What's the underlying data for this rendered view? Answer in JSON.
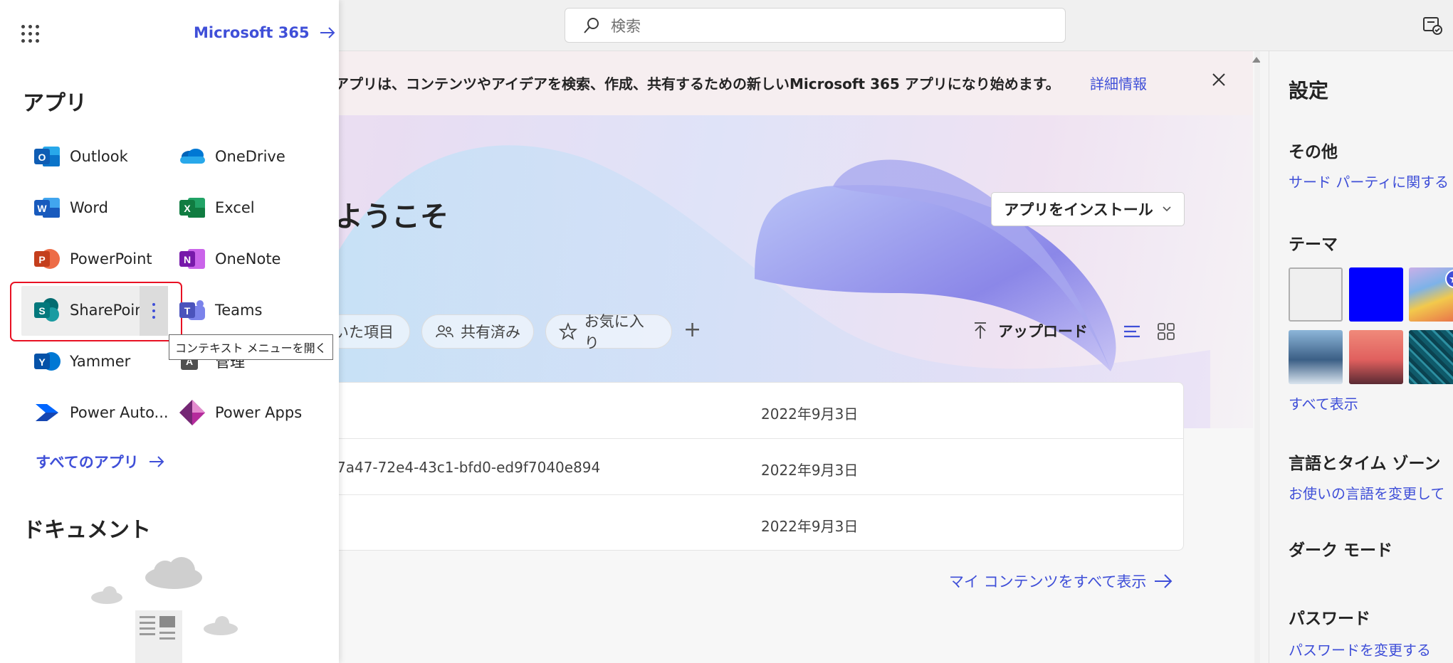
{
  "topbar": {
    "search_placeholder": "検索"
  },
  "banner": {
    "text": "アプリは、コンテンツやアイデアを検索、作成、共有するための新しいMicrosoft 365 アプリになり始めます。",
    "link": "詳細情報"
  },
  "hero": {
    "welcome": "ようこそ",
    "install_button": "アプリをインストール"
  },
  "filters": {
    "items": [
      "いた項目",
      "共有済み",
      "お気に入り"
    ],
    "upload": "アップロード"
  },
  "files": [
    {
      "name": "",
      "date": "2022年9月3日"
    },
    {
      "name": "7a47-72e4-43c1-bfd0-ed9f7040e894",
      "date": "2022年9月3日"
    },
    {
      "name": "",
      "date": "2022年9月3日"
    }
  ],
  "see_all": "マイ コンテンツをすべて表示",
  "settings": {
    "title": "設定",
    "other_heading": "その他",
    "other_link": "サード パーティに関する",
    "theme_heading": "テーマ",
    "theme_show_all": "すべて表示",
    "language_heading": "言語とタイム ゾーン",
    "language_link": "お使いの言語を変更して",
    "dark_mode_heading": "ダーク モード",
    "password_heading": "パスワード",
    "password_link": "パスワードを変更する",
    "swatch_colors": [
      "#efefef",
      "#0000ff"
    ]
  },
  "launcher": {
    "m365_link": "Microsoft 365",
    "apps_heading": "アプリ",
    "apps": [
      {
        "name": "Outlook",
        "icon": "outlook-icon"
      },
      {
        "name": "OneDrive",
        "icon": "onedrive-icon"
      },
      {
        "name": "Word",
        "icon": "word-icon"
      },
      {
        "name": "Excel",
        "icon": "excel-icon"
      },
      {
        "name": "PowerPoint",
        "icon": "powerpoint-icon"
      },
      {
        "name": "OneNote",
        "icon": "onenote-icon"
      },
      {
        "name": "SharePoint",
        "icon": "sharepoint-icon"
      },
      {
        "name": "Teams",
        "icon": "teams-icon"
      },
      {
        "name": "Yammer",
        "icon": "yammer-icon"
      },
      {
        "name": "管理",
        "icon": "admin-icon"
      },
      {
        "name": "Power Auto...",
        "icon": "power-automate-icon"
      },
      {
        "name": "Power Apps",
        "icon": "power-apps-icon"
      }
    ],
    "tooltip": "コンテキスト メニューを開く",
    "all_apps": "すべてのアプリ",
    "documents_heading": "ドキュメント"
  }
}
